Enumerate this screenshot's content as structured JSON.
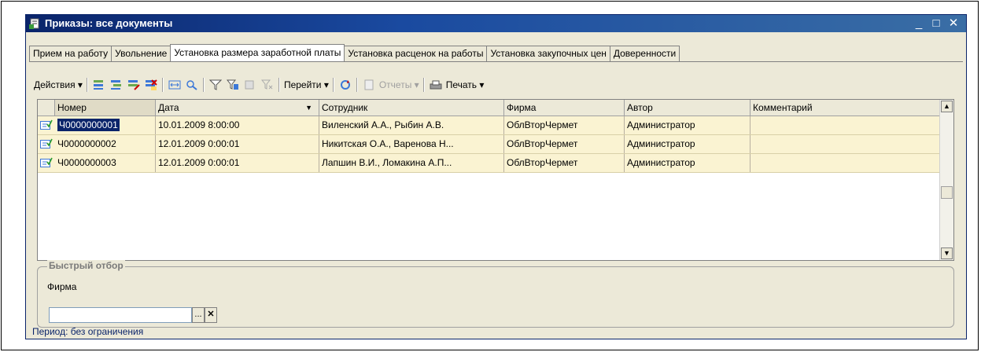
{
  "window": {
    "title": "Приказы: все документы",
    "minimize": "_",
    "maximize": "□",
    "close": "✕"
  },
  "tabs": [
    {
      "label": "Прием на работу"
    },
    {
      "label": "Увольнение"
    },
    {
      "label": "Установка размера заработной платы",
      "active": true
    },
    {
      "label": "Установка расценок на работы"
    },
    {
      "label": "Установка закупочных цен"
    },
    {
      "label": "Доверенности"
    }
  ],
  "toolbar": {
    "actions": "Действия ▾",
    "goto": "Перейти ▾",
    "reports": "Отчеты ▾",
    "print": "Печать ▾"
  },
  "table": {
    "columns": [
      "Номер",
      "Дата",
      "Сотрудник",
      "Фирма",
      "Автор",
      "Комментарий"
    ],
    "sort_indicator": "▼",
    "rows": [
      {
        "number": "Ч0000000001",
        "date": "10.01.2009 8:00:00",
        "employee": "Виленский А.А., Рыбин А.В.",
        "firm": "ОблВторЧермет",
        "author": "Администратор",
        "comment": ""
      },
      {
        "number": "Ч0000000002",
        "date": "12.01.2009 0:00:01",
        "employee": "Никитская О.А., Варенова Н...",
        "firm": "ОблВторЧермет",
        "author": "Администратор",
        "comment": ""
      },
      {
        "number": "Ч0000000003",
        "date": "12.01.2009 0:00:01",
        "employee": "Лапшин В.И., Ломакина А.П...",
        "firm": "ОблВторЧермет",
        "author": "Администратор",
        "comment": ""
      }
    ]
  },
  "quick_filter": {
    "legend": "Быстрый отбор",
    "firm_label": "Фирма",
    "firm_value": "",
    "select_btn": "...",
    "clear_btn": "✕"
  },
  "status": {
    "period": "Период: без ограничения"
  },
  "colors": {
    "title_bar": "#0a246a",
    "row_bg": "#faf3d2",
    "selection": "#0a246a"
  }
}
